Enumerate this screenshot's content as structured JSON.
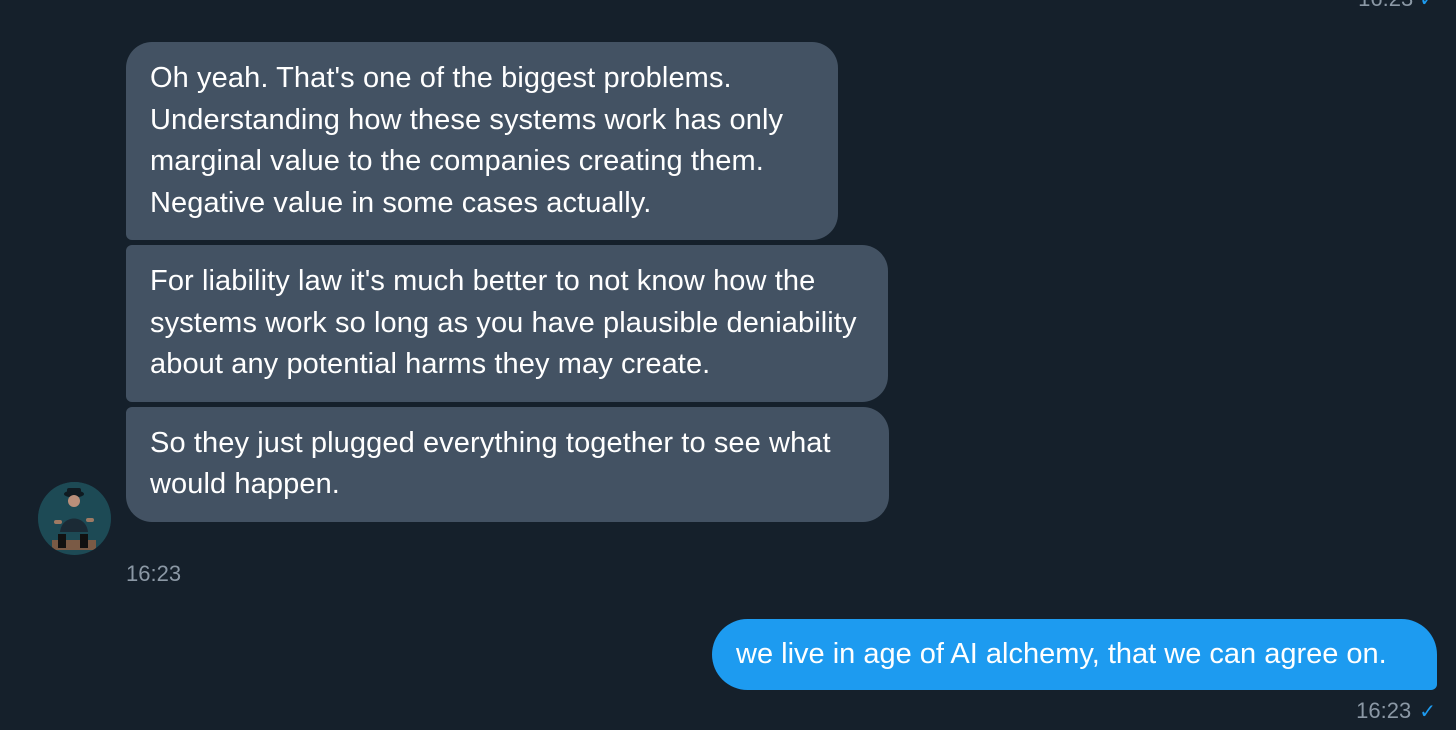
{
  "conversation": {
    "top_timestamp": "16:23",
    "incoming": {
      "messages": [
        {
          "text": "Oh yeah.  That's one of the biggest problems. Understanding how these systems work has only marginal value to the companies creating them. Negative value in some cases actually."
        },
        {
          "text": "For liability law it's much better to not know how the systems work so long as you have plausible deniability about any potential harms they may create."
        },
        {
          "text": "So they just plugged everything together to see what would happen."
        }
      ],
      "timestamp": "16:23",
      "avatar_icon": "user-avatar-icon"
    },
    "outgoing": {
      "text": "we live in age of AI alchemy, that we can agree on.",
      "timestamp": "16:23",
      "status_icon": "check-icon"
    }
  },
  "colors": {
    "background": "#15202b",
    "incoming_bubble": "#435263",
    "outgoing_bubble": "#1d9bf0",
    "timestamp_text": "#8b98a5"
  }
}
